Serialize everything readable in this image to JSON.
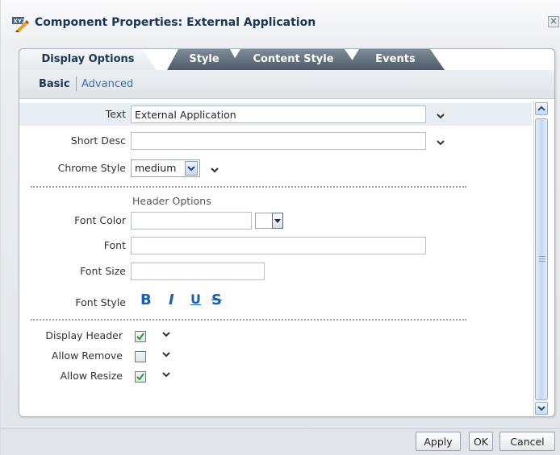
{
  "dialog": {
    "title": "Component Properties: External Application",
    "close_glyph": "✕",
    "title_icon": "properties-icon"
  },
  "tabs": [
    {
      "label": "Display Options",
      "active": true
    },
    {
      "label": "Style",
      "active": false
    },
    {
      "label": "Content Style",
      "active": false
    },
    {
      "label": "Events",
      "active": false
    }
  ],
  "subnav": {
    "basic": "Basic",
    "advanced": "Advanced"
  },
  "fields": {
    "text": {
      "label": "Text",
      "value": "External Application"
    },
    "short_desc": {
      "label": "Short Desc",
      "value": ""
    },
    "chrome_style": {
      "label": "Chrome Style",
      "value": "medium"
    }
  },
  "header_options": {
    "title": "Header Options",
    "font_color": {
      "label": "Font Color",
      "value": ""
    },
    "font": {
      "label": "Font",
      "value": ""
    },
    "font_size": {
      "label": "Font Size",
      "value": ""
    },
    "font_style": {
      "label": "Font Style",
      "bold": "B",
      "italic": "I",
      "underline": "U",
      "strike": "S"
    }
  },
  "checkboxes": [
    {
      "label": "Display Header",
      "checked": true
    },
    {
      "label": "Allow Remove",
      "checked": false
    },
    {
      "label": "Allow Resize",
      "checked": true
    }
  ],
  "footer": {
    "apply": "Apply",
    "ok": "OK",
    "cancel": "Cancel"
  },
  "colors": {
    "title": "#1c3554",
    "link": "#3a6fb0",
    "font_style_icons": "#1b5fb0",
    "check": "#2a9a2a"
  }
}
